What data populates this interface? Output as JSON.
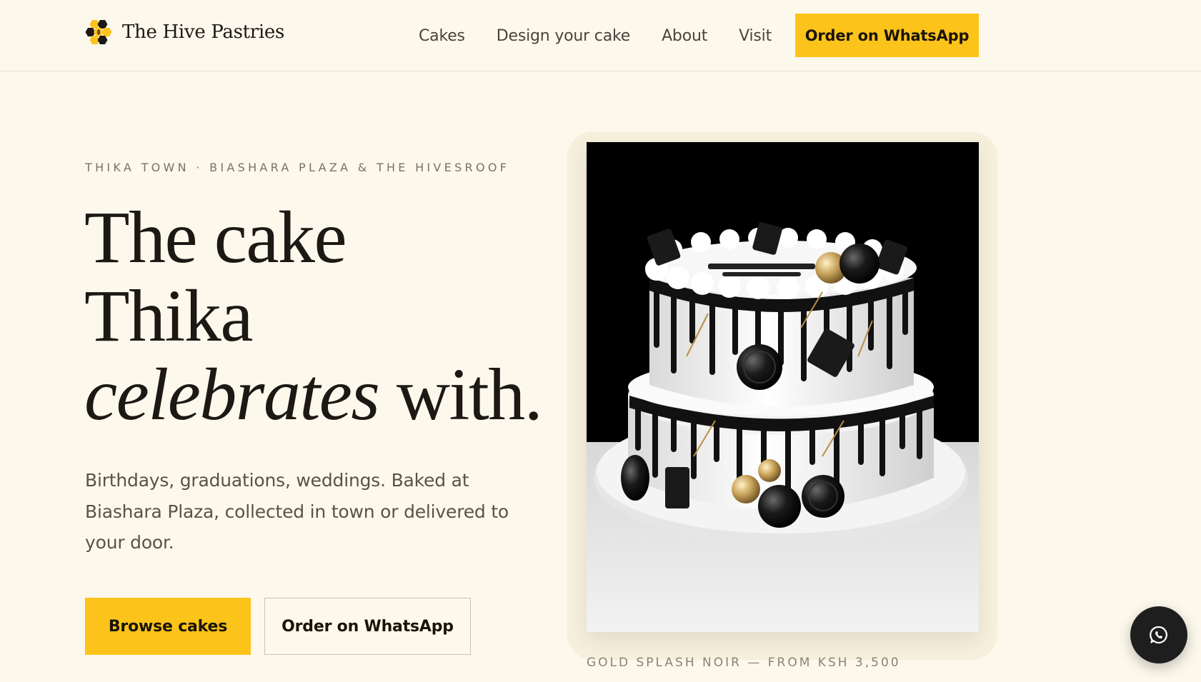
{
  "brand": {
    "name": "The Hive Pastries",
    "logo_icon": "honeycomb-bee-icon",
    "accent": "#fcc41a"
  },
  "nav": {
    "links": [
      "Cakes",
      "Design your cake",
      "About",
      "Visit"
    ],
    "cta_label": "Order on WhatsApp"
  },
  "hero": {
    "eyebrow": "THIKA TOWN · BIASHARA PLAZA & THE HIVESROOF",
    "title_line1": "The cake",
    "title_line2": "Thika",
    "title_line3_italic": "celebrates",
    "title_line3_rest": " with.",
    "description": "Birthdays, graduations, weddings. Baked at Biashara Plaza, collected in town or delivered to your door.",
    "primary_button": "Browse cakes",
    "secondary_button": "Order on WhatsApp"
  },
  "feature_image": {
    "subject": "two-tier white cake with black drip, cookies and gold spheres",
    "caption": "GOLD SPLASH NOIR — FROM KSH 3,500"
  },
  "chat_widget": {
    "icon": "whatsapp-icon"
  }
}
